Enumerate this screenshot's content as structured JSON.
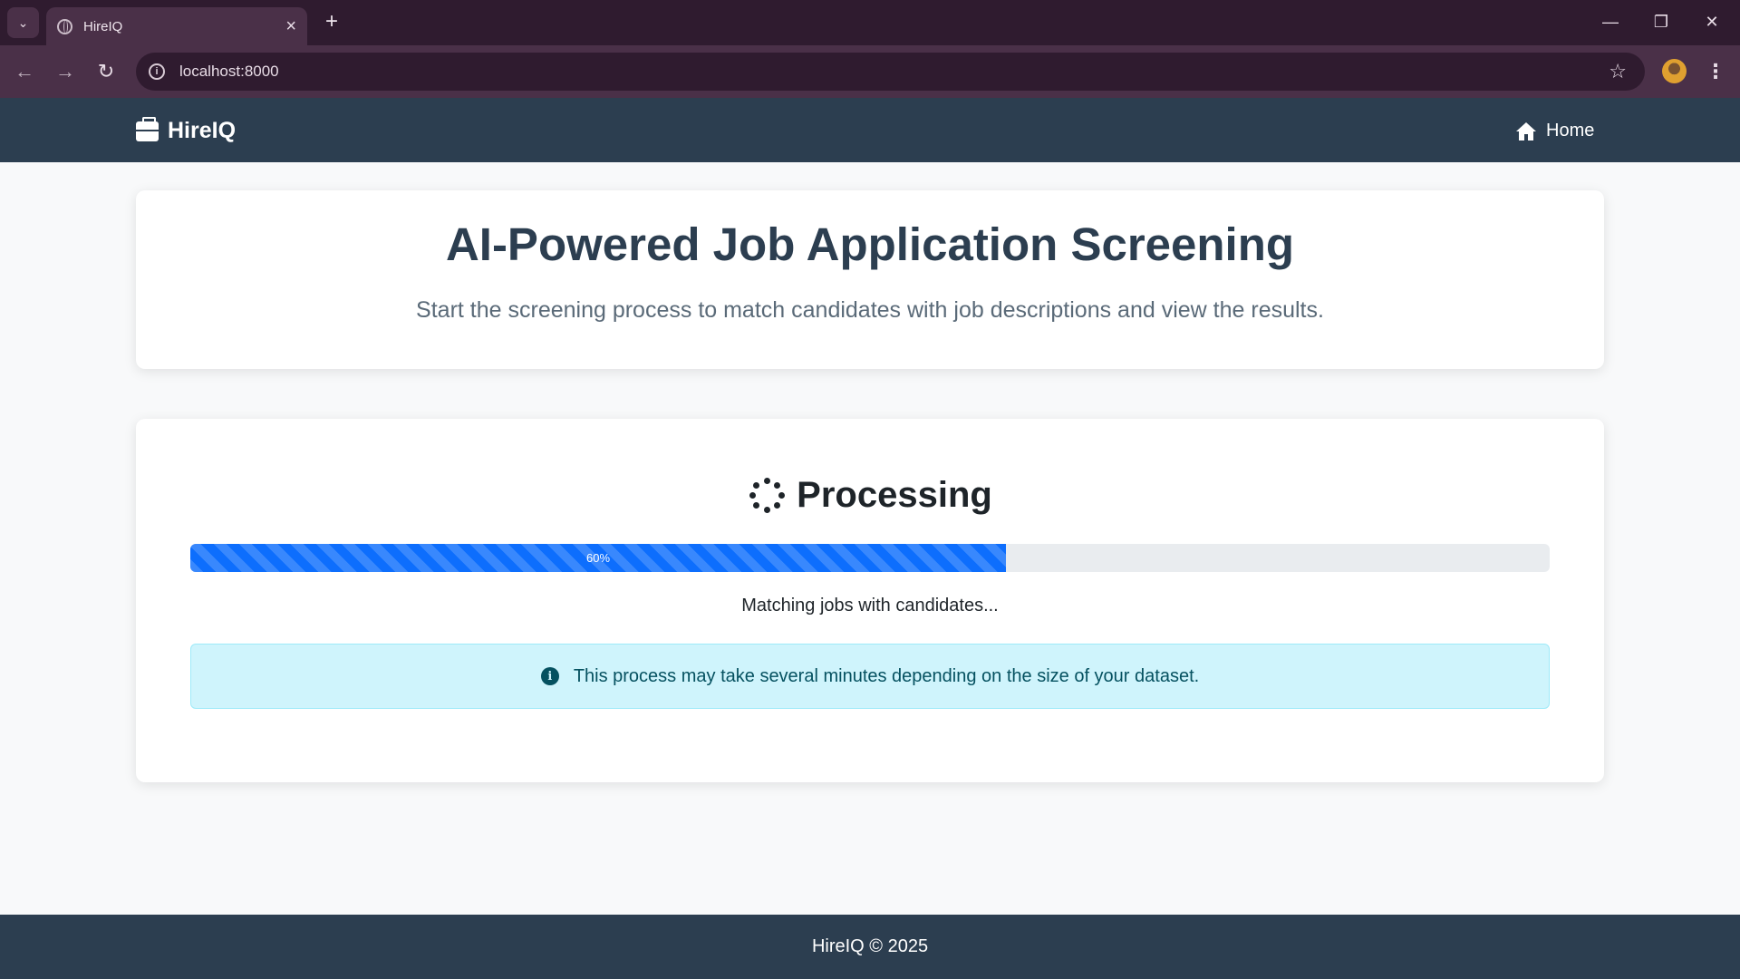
{
  "browser": {
    "tab_title": "HireIQ",
    "url": "localhost:8000"
  },
  "nav": {
    "brand": "HireIQ",
    "home_label": "Home"
  },
  "hero": {
    "title": "AI-Powered Job Application Screening",
    "subtitle": "Start the screening process to match candidates with job descriptions and view the results."
  },
  "processing": {
    "title": "Processing",
    "progress_value": 60,
    "progress_label": "60%",
    "status_text": "Matching jobs with candidates...",
    "info_text": "This process may take several minutes depending on the size of your dataset."
  },
  "footer": {
    "text": "HireIQ © 2025"
  },
  "colors": {
    "navbar": "#2c3e50",
    "progress_fill": "#0d6efd",
    "alert_bg": "#cff4fc",
    "title": "#2c3e50"
  }
}
